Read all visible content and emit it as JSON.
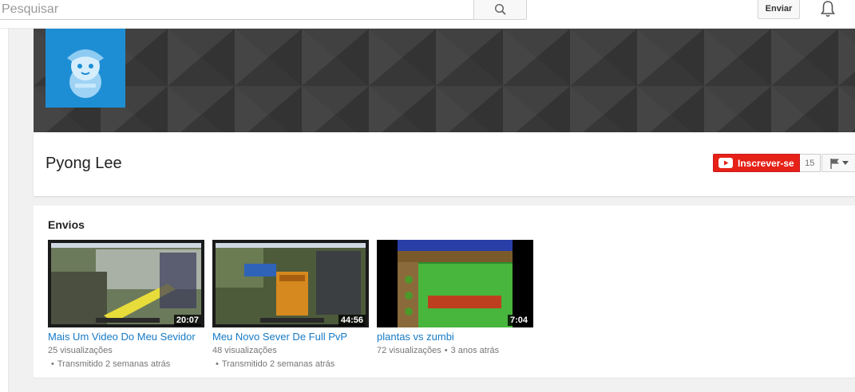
{
  "search": {
    "placeholder": "Pesquisar",
    "icon": "search-icon"
  },
  "header": {
    "upload_label": "Enviar",
    "notifications_icon": "bell-icon"
  },
  "channel": {
    "name": "Pyong Lee",
    "subscribe_label": "Inscrever-se",
    "subscriber_count": "15",
    "banner_color": "#3d3d3d",
    "avatar_color": "#1e8ed4"
  },
  "uploads": {
    "title": "Envios",
    "videos": [
      {
        "title": "Mais Um Video Do Meu Sevidor",
        "duration": "20:07",
        "views": "25 visualizações",
        "age": "Transmitido 2 semanas atrás"
      },
      {
        "title": "Meu Novo Sever De Full PvP",
        "duration": "44:56",
        "views": "48 visualizações",
        "age": "Transmitido 2 semanas atrás"
      },
      {
        "title": "plantas vs zumbi",
        "duration": "7:04",
        "views": "72 visualizações",
        "age": "3 anos atrás"
      }
    ]
  },
  "colors": {
    "accent_red": "#e62117",
    "link_blue": "#167ac6"
  }
}
